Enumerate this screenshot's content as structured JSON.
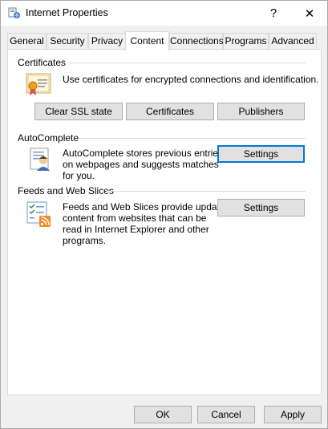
{
  "window": {
    "title": "Internet Properties",
    "help_glyph": "?",
    "close_glyph": "✕"
  },
  "tabs": [
    {
      "label": "General"
    },
    {
      "label": "Security"
    },
    {
      "label": "Privacy"
    },
    {
      "label": "Content",
      "active": true
    },
    {
      "label": "Connections"
    },
    {
      "label": "Programs"
    },
    {
      "label": "Advanced"
    }
  ],
  "certificates": {
    "header": "Certificates",
    "description": "Use certificates for encrypted connections and identification.",
    "buttons": {
      "clear_ssl": "Clear SSL state",
      "certificates": "Certificates",
      "publishers": "Publishers"
    }
  },
  "autocomplete": {
    "header": "AutoComplete",
    "description_lines": [
      "AutoComplete stores previous entries",
      "on webpages and suggests matches",
      "for you."
    ],
    "settings": "Settings"
  },
  "feeds": {
    "header": "Feeds and Web Slices",
    "description_lines": [
      "Feeds and Web Slices provide updated",
      "content from websites that can be",
      "read in Internet Explorer and other",
      "programs."
    ],
    "settings": "Settings"
  },
  "footer": {
    "ok": "OK",
    "cancel": "Cancel",
    "apply": "Apply"
  },
  "colors": {
    "focus_border": "#0078d7",
    "button_face": "#e1e1e1",
    "dialog_bg": "#f0f0f0"
  }
}
